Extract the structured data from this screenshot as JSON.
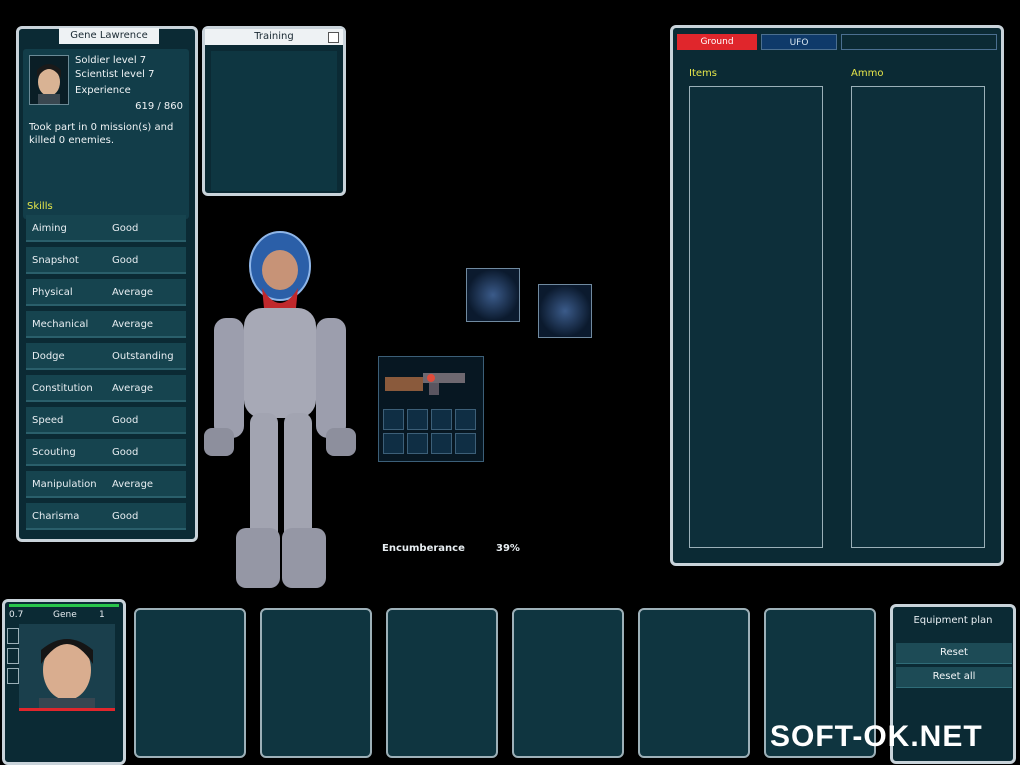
{
  "soldier": {
    "name": "Gene Lawrence",
    "soldier_level": "Soldier level 7",
    "scientist_level": "Scientist level 7",
    "experience_label": "Experience",
    "experience_value": "619 / 860",
    "missions_text": "Took part in 0 mission(s) and killed 0 enemies."
  },
  "training": {
    "title": "Training"
  },
  "skills": {
    "title": "Skills",
    "items": [
      {
        "name": "Aiming",
        "value": "Good"
      },
      {
        "name": "Snapshot",
        "value": "Good"
      },
      {
        "name": "Physical",
        "value": "Average"
      },
      {
        "name": "Mechanical",
        "value": "Average"
      },
      {
        "name": "Dodge",
        "value": "Outstanding"
      },
      {
        "name": "Constitution",
        "value": "Average"
      },
      {
        "name": "Speed",
        "value": "Good"
      },
      {
        "name": "Scouting",
        "value": "Good"
      },
      {
        "name": "Manipulation",
        "value": "Average"
      },
      {
        "name": "Charisma",
        "value": "Good"
      }
    ]
  },
  "inventory": {
    "tabs": [
      "Ground",
      "UFO"
    ],
    "active_tab": "Ground",
    "items_label": "Items",
    "ammo_label": "Ammo"
  },
  "encumbrance": {
    "label": "Encumberance",
    "value": "39%"
  },
  "squad": {
    "member": {
      "left_value": "0.7",
      "name": "Gene",
      "right_value": "1"
    }
  },
  "equipment_plan": {
    "title": "Equipment plan",
    "reset": "Reset",
    "reset_all": "Reset all"
  },
  "watermark": "SOFT-OK.NET",
  "colors": {
    "accent_red": "#e0262c",
    "panel_teal": "#0d2f3a",
    "skill_yellow": "#e6e64a"
  }
}
